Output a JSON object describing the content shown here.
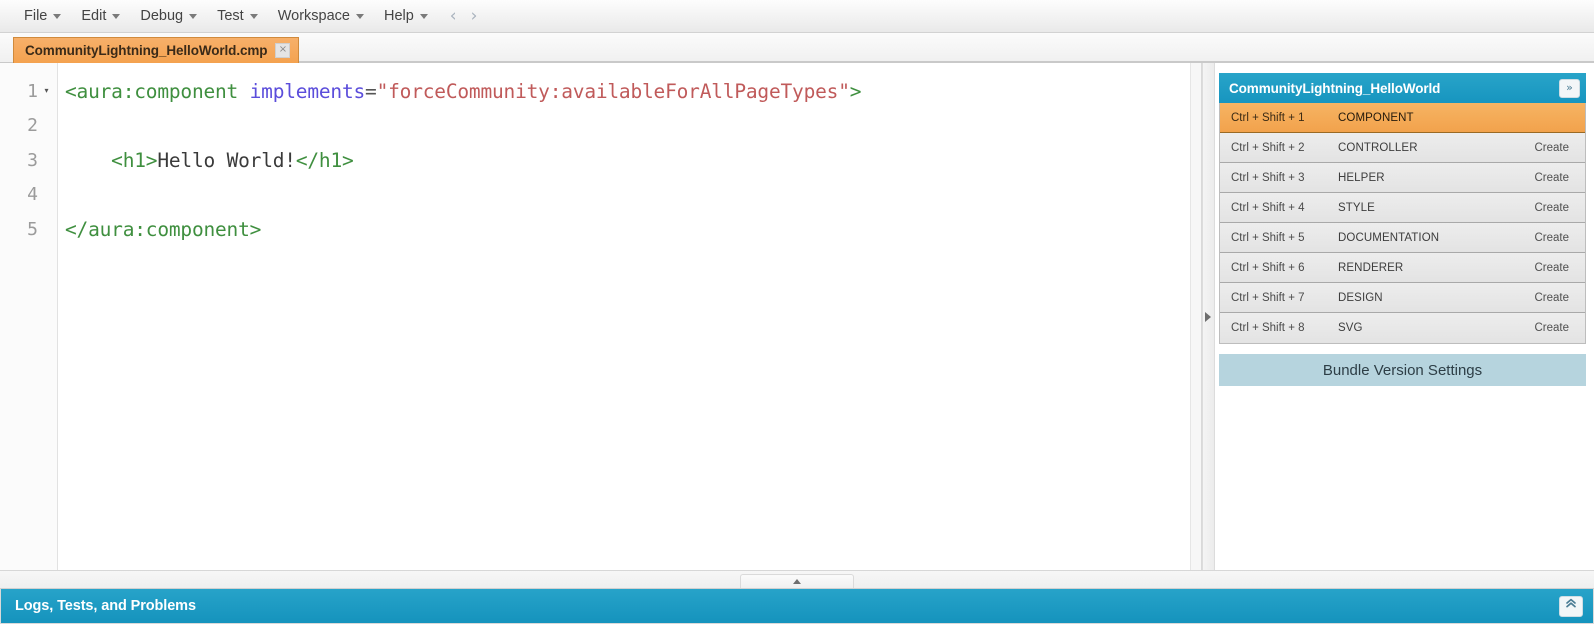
{
  "menubar": {
    "items": [
      {
        "label": "File",
        "has_caret": true
      },
      {
        "label": "Edit",
        "has_caret": true
      },
      {
        "label": "Debug",
        "has_caret": true
      },
      {
        "label": "Test",
        "has_caret": true
      },
      {
        "label": "Workspace",
        "has_caret": true
      },
      {
        "label": "Help",
        "has_caret": true
      }
    ],
    "nav_back": "‹",
    "nav_forward": "›"
  },
  "tabs": [
    {
      "label": "CommunityLightning_HelloWorld.cmp",
      "close": "×",
      "active": true
    }
  ],
  "editor": {
    "lines": [
      {
        "number": "1",
        "fold": "▾",
        "tokens": [
          {
            "text": "<aura:component ",
            "type": "tag"
          },
          {
            "text": "implements",
            "type": "attr"
          },
          {
            "text": "=",
            "type": "eq"
          },
          {
            "text": "\"forceCommunity:availableForAllPageTypes\"",
            "type": "str"
          },
          {
            "text": ">",
            "type": "punct"
          }
        ]
      },
      {
        "number": "2",
        "fold": "",
        "tokens": []
      },
      {
        "number": "3",
        "fold": "",
        "tokens": [
          {
            "text": "    ",
            "type": "text"
          },
          {
            "text": "<h1>",
            "type": "tag"
          },
          {
            "text": "Hello World!",
            "type": "text"
          },
          {
            "text": "</h1>",
            "type": "tag"
          }
        ]
      },
      {
        "number": "4",
        "fold": "",
        "tokens": []
      },
      {
        "number": "5",
        "fold": "",
        "tokens": [
          {
            "text": "</aura:component>",
            "type": "tag"
          }
        ]
      }
    ]
  },
  "sidebar": {
    "title": "CommunityLightning_HelloWorld",
    "collapse_icon": "»",
    "rows": [
      {
        "shortcut": "Ctrl + Shift + 1",
        "name": "COMPONENT",
        "action": "",
        "active": true
      },
      {
        "shortcut": "Ctrl + Shift + 2",
        "name": "CONTROLLER",
        "action": "Create",
        "active": false
      },
      {
        "shortcut": "Ctrl + Shift + 3",
        "name": "HELPER",
        "action": "Create",
        "active": false
      },
      {
        "shortcut": "Ctrl + Shift + 4",
        "name": "STYLE",
        "action": "Create",
        "active": false
      },
      {
        "shortcut": "Ctrl + Shift + 5",
        "name": "DOCUMENTATION",
        "action": "Create",
        "active": false
      },
      {
        "shortcut": "Ctrl + Shift + 6",
        "name": "RENDERER",
        "action": "Create",
        "active": false
      },
      {
        "shortcut": "Ctrl + Shift + 7",
        "name": "DESIGN",
        "action": "Create",
        "active": false
      },
      {
        "shortcut": "Ctrl + Shift + 8",
        "name": "SVG",
        "action": "Create",
        "active": false
      }
    ],
    "bundle_version_settings": "Bundle Version Settings"
  },
  "bottombar": {
    "title": "Logs, Tests, and Problems",
    "expand_icon": "«"
  },
  "colors": {
    "accent_blue": "#1a9bc4",
    "tab_orange": "#f4a24f",
    "row_active_orange": "#f2a24c",
    "bundle_blue": "#b6d4de",
    "code_tag_green": "#3f8f3f",
    "code_attr_purple": "#5b4ddb",
    "code_string_red": "#c05a5a"
  }
}
